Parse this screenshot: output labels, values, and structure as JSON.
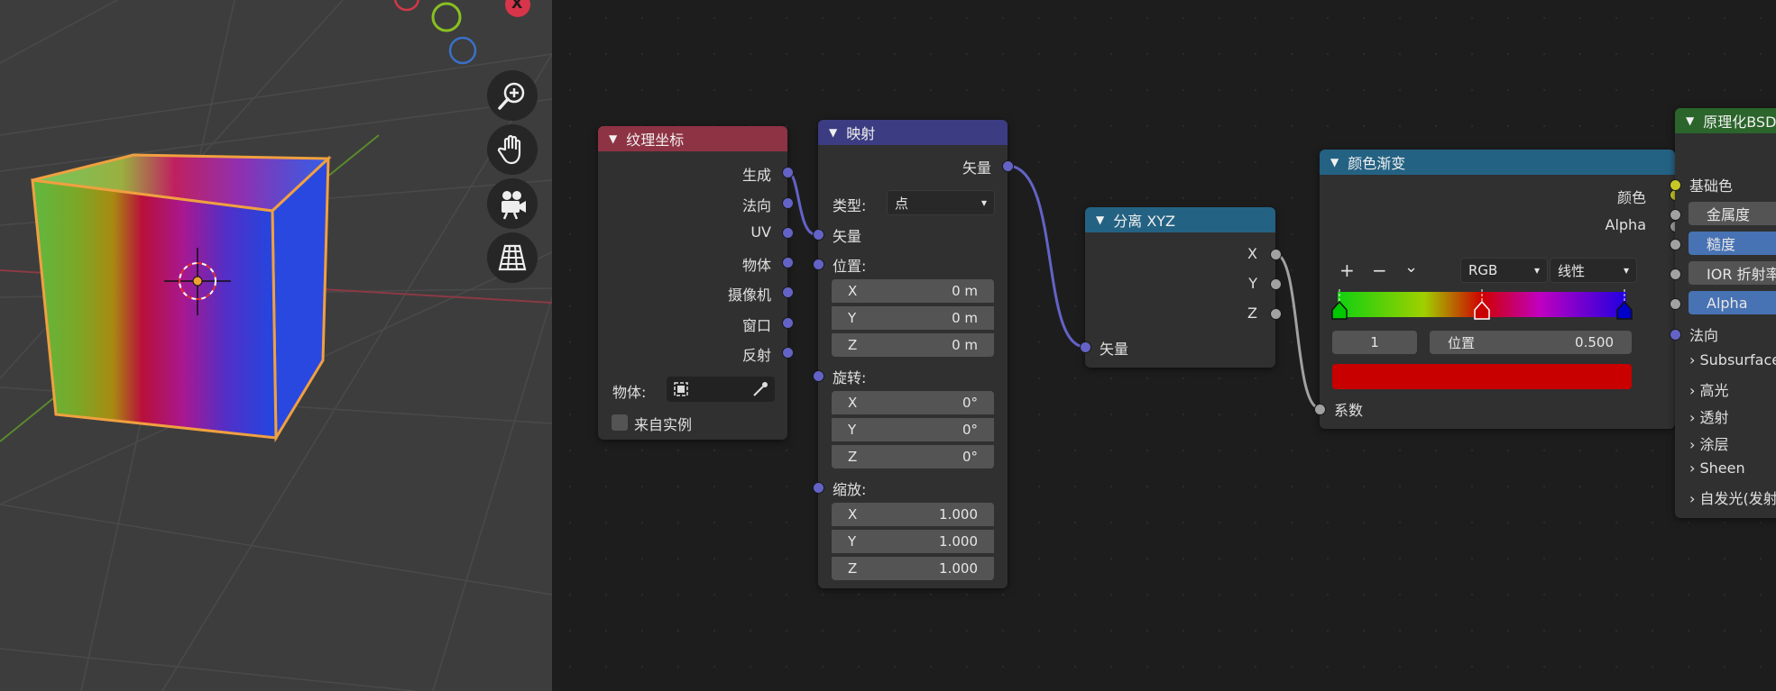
{
  "viewport": {
    "gizmo_x_label": "X",
    "nav_icons": [
      "zoom-icon",
      "hand-pan-icon",
      "camera-icon",
      "grid-perspective-icon"
    ]
  },
  "texcoord": {
    "title": "纹理坐标",
    "outputs": [
      "生成",
      "法向",
      "UV",
      "物体",
      "摄像机",
      "窗口",
      "反射"
    ],
    "object_label": "物体:",
    "from_instancer": "来自实例",
    "header_color": "#8e3344"
  },
  "mapping": {
    "title": "映射",
    "output": "矢量",
    "type_label": "类型:",
    "type_value": "点",
    "vector_label": "矢量",
    "location_label": "位置:",
    "location": [
      {
        "axis": "X",
        "value": "0 m"
      },
      {
        "axis": "Y",
        "value": "0 m"
      },
      {
        "axis": "Z",
        "value": "0 m"
      }
    ],
    "rotation_label": "旋转:",
    "rotation": [
      {
        "axis": "X",
        "value": "0°"
      },
      {
        "axis": "Y",
        "value": "0°"
      },
      {
        "axis": "Z",
        "value": "0°"
      }
    ],
    "scale_label": "缩放:",
    "scale": [
      {
        "axis": "X",
        "value": "1.000"
      },
      {
        "axis": "Y",
        "value": "1.000"
      },
      {
        "axis": "Z",
        "value": "1.000"
      }
    ],
    "header_color": "#3c3c83"
  },
  "separate": {
    "title": "分离 XYZ",
    "outputs": [
      "X",
      "Y",
      "Z"
    ],
    "input": "矢量",
    "header_color": "#246283"
  },
  "ramp": {
    "title": "颜色渐变",
    "out_color": "颜色",
    "out_alpha": "Alpha",
    "add": "+",
    "remove": "−",
    "menu": "⌄",
    "mode": "RGB",
    "interp": "线性",
    "index": "1",
    "pos_label": "位置",
    "pos_value": "0.500",
    "factor": "系数",
    "selected_color": "#c80000",
    "stop_colors": [
      "#00c800",
      "#c80000",
      "#0000c8"
    ],
    "header_color": "#246283"
  },
  "bsdf": {
    "title": "原理化BSDF",
    "base_color": "基础色",
    "metallic": "金属度",
    "roughness": "糙度",
    "ior": "IOR 折射率",
    "alpha": "Alpha",
    "normal": "法向",
    "panels": [
      "Subsurface",
      "高光",
      "透射",
      "涂层",
      "Sheen",
      "自发光(发射)"
    ],
    "header_color": "#2b652b"
  }
}
